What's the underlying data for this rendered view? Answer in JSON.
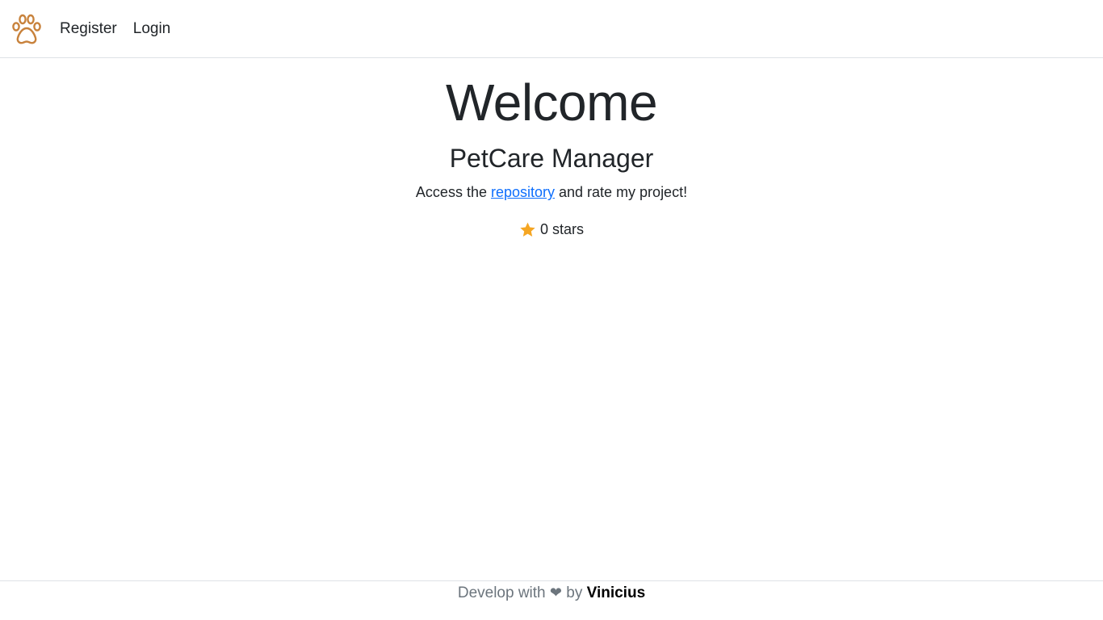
{
  "nav": {
    "logo_icon": "paw-icon",
    "links": [
      {
        "label": "Register"
      },
      {
        "label": "Login"
      }
    ]
  },
  "hero": {
    "title": "Welcome",
    "subtitle": "PetCare Manager",
    "access_prefix": "Access the ",
    "link_text": "repository",
    "access_suffix": " and rate my project!",
    "star_icon": "star-icon",
    "stars_text": "0 stars"
  },
  "footer": {
    "prefix": "Develop with ",
    "heart": "❤",
    "by": " by ",
    "author": "Vinicius"
  },
  "colors": {
    "paw": "#c8823c",
    "star": "#f5a623",
    "link": "#0d6efd",
    "border": "#dee2e6",
    "muted": "#6c757d"
  }
}
